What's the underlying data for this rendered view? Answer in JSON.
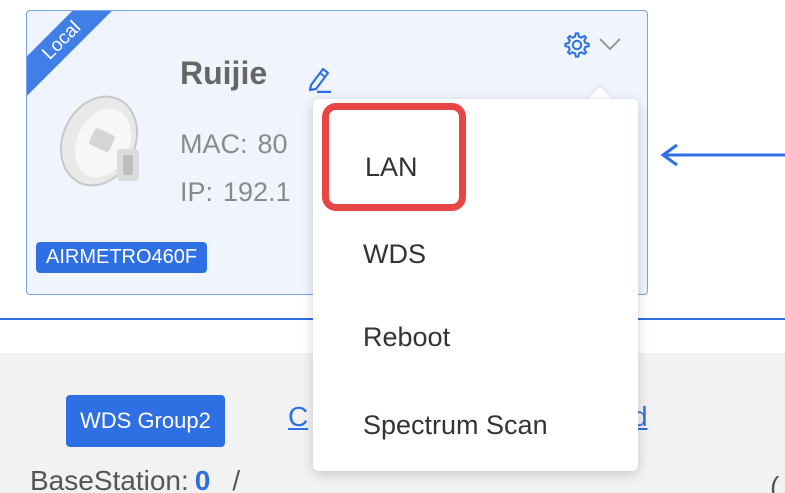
{
  "device": {
    "corner_label": "Local",
    "name": "Ruijie",
    "mac_label": "MAC:",
    "mac_value": "80",
    "ip_label": "IP:",
    "ip_value": "192.1",
    "model": "AIRMETRO460F"
  },
  "dropdown": {
    "items": [
      {
        "label": "LAN"
      },
      {
        "label": "WDS"
      },
      {
        "label": "Reboot"
      },
      {
        "label": "Spectrum Scan"
      }
    ]
  },
  "lower": {
    "group_label": "WDS Group2",
    "link_left_fragment": "C",
    "link_right_fragment": "d",
    "base_station_label": "BaseStation:",
    "base_station_count": "0",
    "base_station_suffix": "/",
    "right_fragment": "("
  },
  "colors": {
    "accent": "#2f6fe4",
    "highlight": "#e84545"
  }
}
